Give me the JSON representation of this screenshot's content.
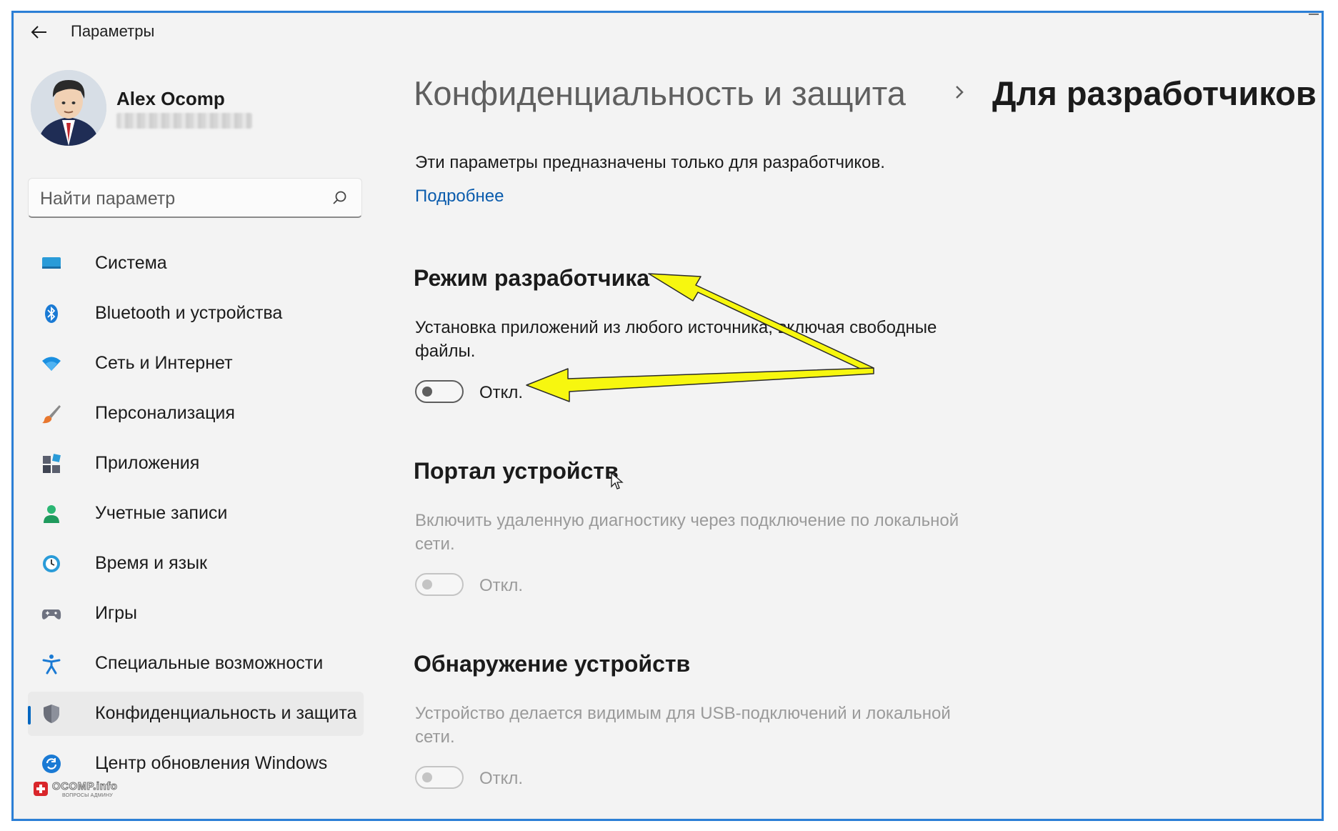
{
  "window": {
    "title": "Параметры",
    "accent_color": "#0067c0",
    "frame_color": "#2b7fd6"
  },
  "profile": {
    "name": "Alex Ocomp",
    "email": ""
  },
  "search": {
    "placeholder": "Найти параметр",
    "value": "",
    "icon": "search-icon"
  },
  "nav": {
    "items": [
      {
        "label": "Система",
        "icon": "system-icon",
        "selected": false
      },
      {
        "label": "Bluetooth и устройства",
        "icon": "bluetooth-icon",
        "selected": false
      },
      {
        "label": "Сеть и Интернет",
        "icon": "wifi-icon",
        "selected": false
      },
      {
        "label": "Персонализация",
        "icon": "brush-icon",
        "selected": false
      },
      {
        "label": "Приложения",
        "icon": "apps-icon",
        "selected": false
      },
      {
        "label": "Учетные записи",
        "icon": "account-icon",
        "selected": false
      },
      {
        "label": "Время и язык",
        "icon": "clock-icon",
        "selected": false
      },
      {
        "label": "Игры",
        "icon": "gamepad-icon",
        "selected": false
      },
      {
        "label": "Специальные возможности",
        "icon": "accessibility-icon",
        "selected": false
      },
      {
        "label": "Конфиденциальность и защита",
        "icon": "shield-icon",
        "selected": true
      },
      {
        "label": "Центр обновления Windows",
        "icon": "update-icon",
        "selected": false
      }
    ]
  },
  "header": {
    "parent": "Конфиденциальность и защита",
    "separator": "chevron-right-icon",
    "current": "Для разработчиков"
  },
  "content": {
    "intro": "Эти параметры предназначены только для разработчиков.",
    "more_link": "Подробнее",
    "sections": [
      {
        "title": "Режим разработчика",
        "description": "Установка приложений из любого источника, включая свободные файлы.",
        "toggle_state": "Откл.",
        "enabled": true
      },
      {
        "title": "Портал устройств",
        "description": "Включить удаленную диагностику через подключение по локальной сети.",
        "toggle_state": "Откл.",
        "enabled": false
      },
      {
        "title": "Обнаружение устройств",
        "description": "Устройство делается видимым для USB-подключений и локальной сети.",
        "toggle_state": "Откл.",
        "enabled": false
      }
    ]
  },
  "annotation": {
    "arrow_color": "#f7f70f",
    "arrow_outline": "#2a2a2a"
  },
  "watermark": {
    "text": "OCOMP.info",
    "subtext": "ВОПРОСЫ АДМИНУ"
  }
}
